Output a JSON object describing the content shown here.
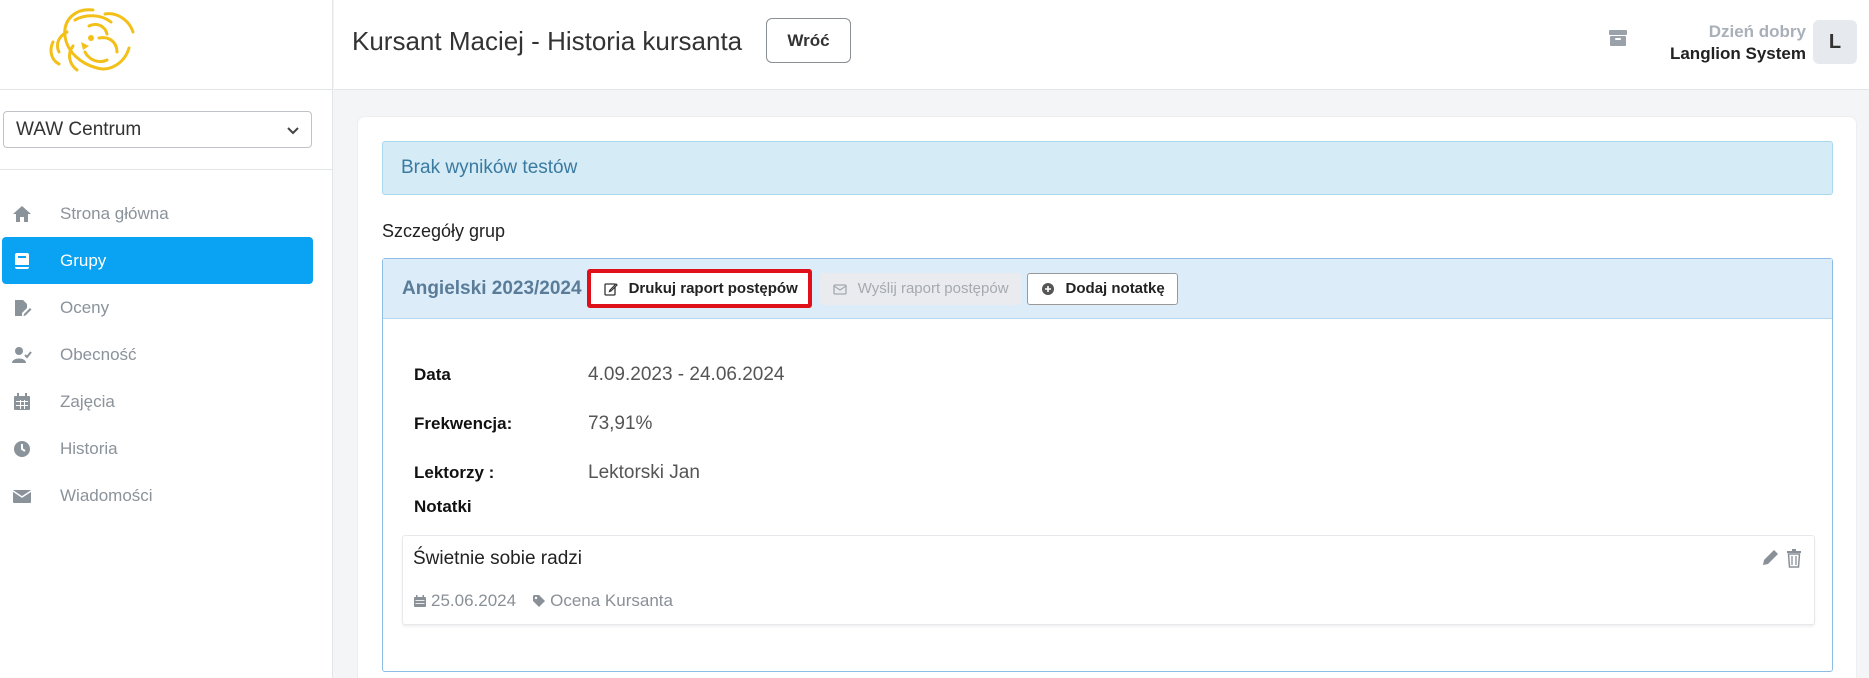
{
  "sidebar": {
    "branch_select": {
      "value": "WAW Centrum"
    },
    "items": [
      {
        "label": "Strona główna",
        "icon": "home-icon",
        "active": false
      },
      {
        "label": "Grupy",
        "icon": "book-icon",
        "active": true
      },
      {
        "label": "Oceny",
        "icon": "edit-document-icon",
        "active": false
      },
      {
        "label": "Obecność",
        "icon": "user-check-icon",
        "active": false
      },
      {
        "label": "Zajęcia",
        "icon": "calendar-icon",
        "active": false
      },
      {
        "label": "Historia",
        "icon": "clock-icon",
        "active": false
      },
      {
        "label": "Wiadomości",
        "icon": "envelope-icon",
        "active": false
      }
    ]
  },
  "header": {
    "title": "Kursant Maciej - Historia kursanta",
    "back_label": "Wróć",
    "greeting": "Dzień dobry",
    "user_name": "Langlion System",
    "avatar_initial": "L"
  },
  "main": {
    "alert": "Brak wyników testów",
    "section_label": "Szczegóły grup",
    "group": {
      "name": "Angielski 2023/2024",
      "print_label": "Drukuj raport postępów",
      "send_label": "Wyślij raport postępów",
      "add_note_label": "Dodaj notatkę",
      "details": [
        {
          "key": "Data",
          "value": "4.09.2023 - 24.06.2024"
        },
        {
          "key": "Frekwencja:",
          "value": "73,91%"
        },
        {
          "key": "Lektorzy :",
          "value": "Lektorski Jan"
        }
      ],
      "notes_label": "Notatki",
      "note": {
        "text": "Świetnie sobie radzi",
        "date": "25.06.2024",
        "tag": "Ocena Kursanta"
      }
    }
  },
  "colors": {
    "accent": "#0aa2f2",
    "alert_bg": "#d5ecf6",
    "group_head_bg": "#dcedf9",
    "highlight_border": "#e0101a",
    "logo": "#f2c018"
  }
}
